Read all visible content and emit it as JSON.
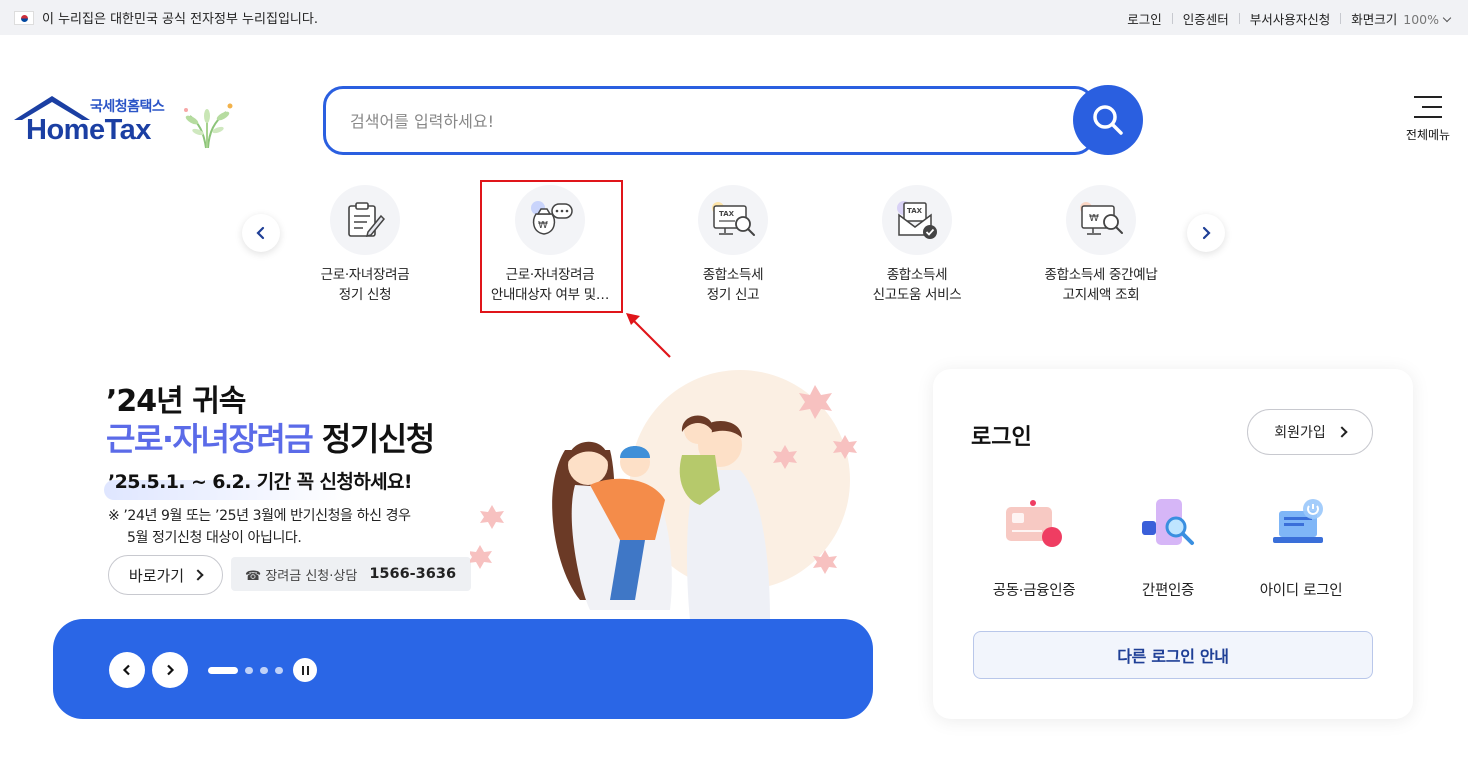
{
  "gov_bar": {
    "notice": "이 누리집은 대한민국 공식 전자정부 누리집입니다.",
    "links": [
      "로그인",
      "인증센터",
      "부서사용자신청"
    ],
    "zoom_label": "화면크기",
    "zoom_value": "100%"
  },
  "logo": {
    "sub": "국세청홈택스",
    "main": "HomeTax"
  },
  "search": {
    "placeholder": "검색어를 입력하세요!"
  },
  "menu": {
    "label": "전체메뉴"
  },
  "quick_menu": [
    {
      "line1": "근로·자녀장려금",
      "line2": "정기 신청",
      "icon": "form-pen-icon"
    },
    {
      "line1": "근로·자녀장려금",
      "line2": "안내대상자 여부 및…",
      "icon": "money-bag-chat-icon"
    },
    {
      "line1": "종합소득세",
      "line2": "정기 신고",
      "icon": "tax-monitor-search-icon"
    },
    {
      "line1": "종합소득세",
      "line2": "신고도움 서비스",
      "icon": "tax-envelope-check-icon"
    },
    {
      "line1": "종합소득세 중간예납",
      "line2": "고지세액 조회",
      "icon": "won-monitor-search-icon"
    }
  ],
  "promo": {
    "line1": "’24년 귀속",
    "line2_highlight": "근로·자녀장려금",
    "line2_rest": " 정기신청",
    "date_line": "’25.5.1. ~ 6.2. 기간 꼭 신청하세요!",
    "note_line1": "※ ’24년 9월 또는 ’25년 3월에 반기신청을 하신 경우",
    "note_line2": "5월 정기신청 대상이 아닙니다.",
    "goto_label": "바로가기",
    "phone_label": "☎ 장려금 신청·상담",
    "phone_number": "1566-3636"
  },
  "login": {
    "title": "로그인",
    "join_label": "회원가입",
    "options": [
      "공동·금융인증",
      "간편인증",
      "아이디 로그인"
    ],
    "other_label": "다른 로그인 안내"
  },
  "colors": {
    "primary": "#2a5fe0",
    "highlight_text": "#5b6be8",
    "annotation": "#e0151a"
  }
}
